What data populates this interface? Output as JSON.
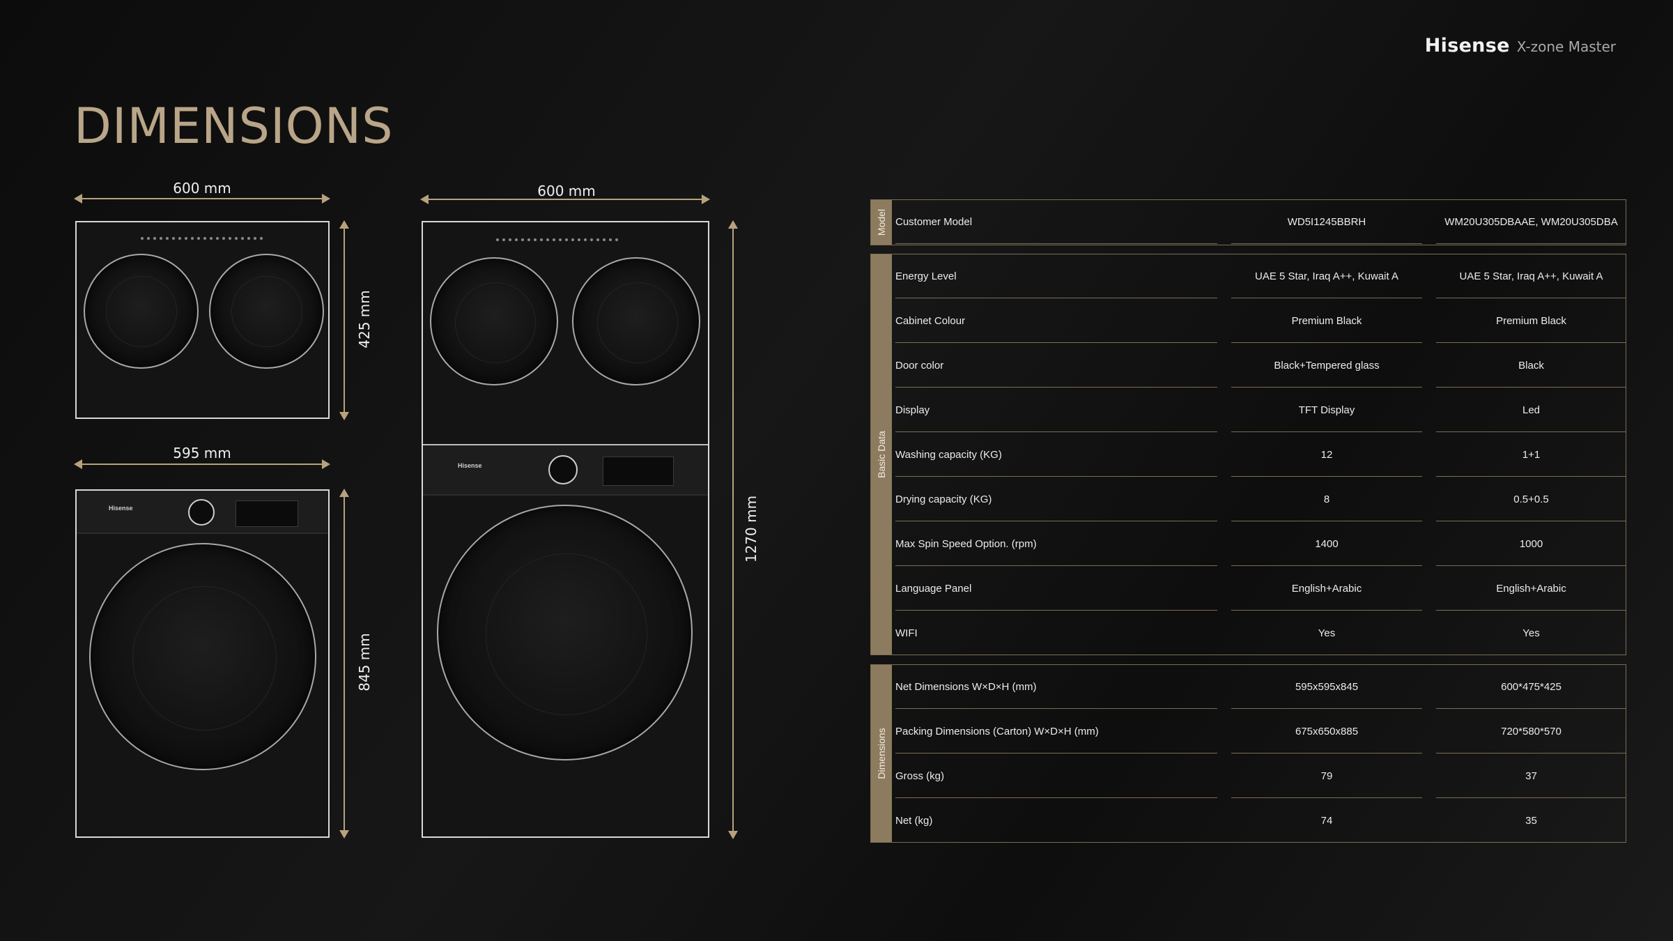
{
  "brand": {
    "logo": "Hisense",
    "sub": "X-zone Master"
  },
  "title": "DIMENSIONS",
  "dimensions": {
    "top_width": "600 mm",
    "top_height": "425 mm",
    "bottom_width": "595 mm",
    "bottom_height": "845 mm",
    "stack_width": "600 mm",
    "stack_height": "1270 mm"
  },
  "appliance": {
    "panel_brand": "Hisense"
  },
  "table": {
    "model_group": {
      "label": "Model",
      "rows": [
        {
          "name": "Customer Model",
          "v1": "WD5I1245BBRH",
          "v2": "WM20U305DBAAE, WM20U305DBA"
        }
      ]
    },
    "basic_group": {
      "label": "Basic Data",
      "rows": [
        {
          "name": "Energy Level",
          "v1": "UAE 5 Star, Iraq A++, Kuwait A",
          "v2": "UAE 5 Star, Iraq A++, Kuwait A"
        },
        {
          "name": "Cabinet Colour",
          "v1": "Premium Black",
          "v2": "Premium Black"
        },
        {
          "name": "Door color",
          "v1": "Black+Tempered glass",
          "v2": "Black"
        },
        {
          "name": "Display",
          "v1": "TFT Display",
          "v2": "Led"
        },
        {
          "name": "Washing capacity (KG)",
          "v1": "12",
          "v2": "1+1"
        },
        {
          "name": "Drying capacity (KG)",
          "v1": "8",
          "v2": "0.5+0.5"
        },
        {
          "name": "Max Spin Speed Option. (rpm)",
          "v1": "1400",
          "v2": "1000"
        },
        {
          "name": "Language Panel",
          "v1": "English+Arabic",
          "v2": "English+Arabic"
        },
        {
          "name": "WIFI",
          "v1": "Yes",
          "v2": "Yes"
        }
      ]
    },
    "dims_group": {
      "label": "Dimensions",
      "rows": [
        {
          "name": "Net Dimensions W×D×H (mm)",
          "v1": "595x595x845",
          "v2": "600*475*425"
        },
        {
          "name": "Packing Dimensions (Carton) W×D×H (mm)",
          "v1": "675x650x885",
          "v2": "720*580*570"
        },
        {
          "name": "Gross (kg)",
          "v1": "79",
          "v2": "37"
        },
        {
          "name": "Net (kg)",
          "v1": "74",
          "v2": "35"
        }
      ]
    }
  }
}
